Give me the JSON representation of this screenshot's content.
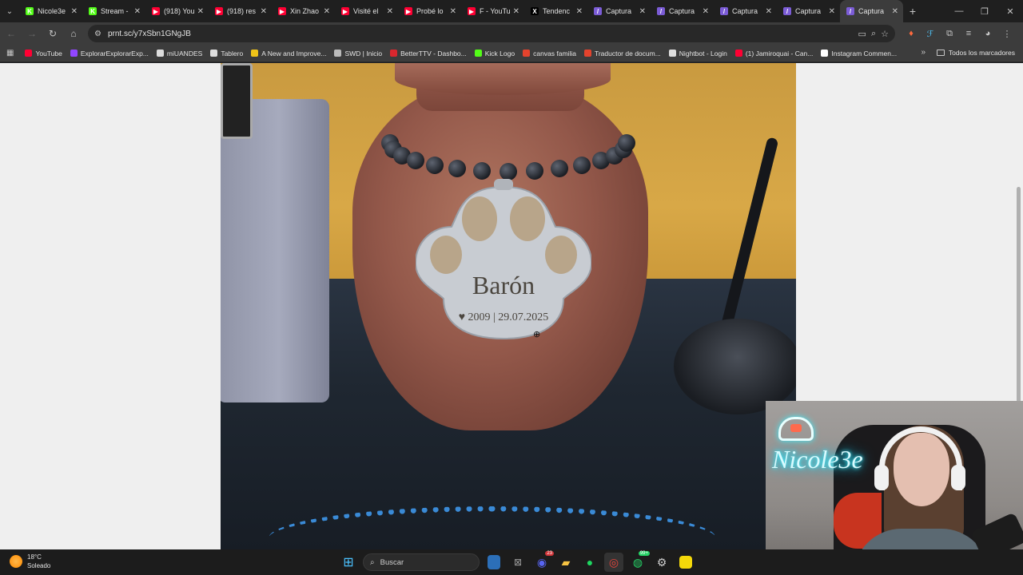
{
  "tabs": [
    {
      "title": "Nicole3e",
      "fav_color": "#53fc18",
      "fav_glyph": "K"
    },
    {
      "title": "Stream -",
      "fav_color": "#53fc18",
      "fav_glyph": "K"
    },
    {
      "title": "(918) You",
      "fav_color": "#ff0033",
      "fav_glyph": "▶"
    },
    {
      "title": "(918) res",
      "fav_color": "#ff0033",
      "fav_glyph": "▶"
    },
    {
      "title": "Xin Zhao",
      "fav_color": "#ff0033",
      "fav_glyph": "▶"
    },
    {
      "title": "Visité el",
      "fav_color": "#ff0033",
      "fav_glyph": "▶"
    },
    {
      "title": "Probé lo",
      "fav_color": "#ff0033",
      "fav_glyph": "▶"
    },
    {
      "title": "F - YouTu",
      "fav_color": "#ff0033",
      "fav_glyph": "▶"
    },
    {
      "title": "Tendenc",
      "fav_color": "#000000",
      "fav_glyph": "X"
    },
    {
      "title": "Captura",
      "fav_color": "#7b5cd6",
      "fav_glyph": "/"
    },
    {
      "title": "Captura",
      "fav_color": "#7b5cd6",
      "fav_glyph": "/"
    },
    {
      "title": "Captura",
      "fav_color": "#7b5cd6",
      "fav_glyph": "/"
    },
    {
      "title": "Captura",
      "fav_color": "#7b5cd6",
      "fav_glyph": "/"
    },
    {
      "title": "Captura",
      "fav_color": "#7b5cd6",
      "fav_glyph": "/",
      "active": true
    }
  ],
  "address": {
    "url": "prnt.sc/y7xSbn1GNgJB"
  },
  "bookmarks": [
    {
      "label": "YouTube",
      "color": "#ff0033"
    },
    {
      "label": "ExplorarExplorarExp...",
      "color": "#9146ff"
    },
    {
      "label": "miUANDES",
      "color": "#dddddd"
    },
    {
      "label": "Tablero",
      "color": "#dddddd"
    },
    {
      "label": "A New and Improve...",
      "color": "#f0c419"
    },
    {
      "label": "SWD | Inicio",
      "color": "#bbbbbb"
    },
    {
      "label": "BetterTTV - Dashbo...",
      "color": "#d9272e"
    },
    {
      "label": "Kick Logo",
      "color": "#53fc18"
    },
    {
      "label": "canvas familia",
      "color": "#e4432d"
    },
    {
      "label": "Traductor de docum...",
      "color": "#e4432d"
    },
    {
      "label": "Nightbot - Login",
      "color": "#dddddd"
    },
    {
      "label": "(1) Jamiroquai - Can...",
      "color": "#ff0033"
    },
    {
      "label": "Instagram Commen...",
      "color": "#ffffff"
    }
  ],
  "bookmarks_all": "Todos los marcadores",
  "tag": {
    "name": "Barón",
    "dates": "♥ 2009 | 29.07.2025"
  },
  "webcam": {
    "sign": "Nicole3e"
  },
  "taskbar": {
    "temp": "18°C",
    "weather": "Soleado",
    "search_placeholder": "Buscar",
    "discord_badge": "23",
    "whatsapp_badge": "99+"
  },
  "colors": {
    "accent": "#8ab4f8",
    "page_bg": "#efefef",
    "chrome_dark": "#3c3c3c"
  }
}
